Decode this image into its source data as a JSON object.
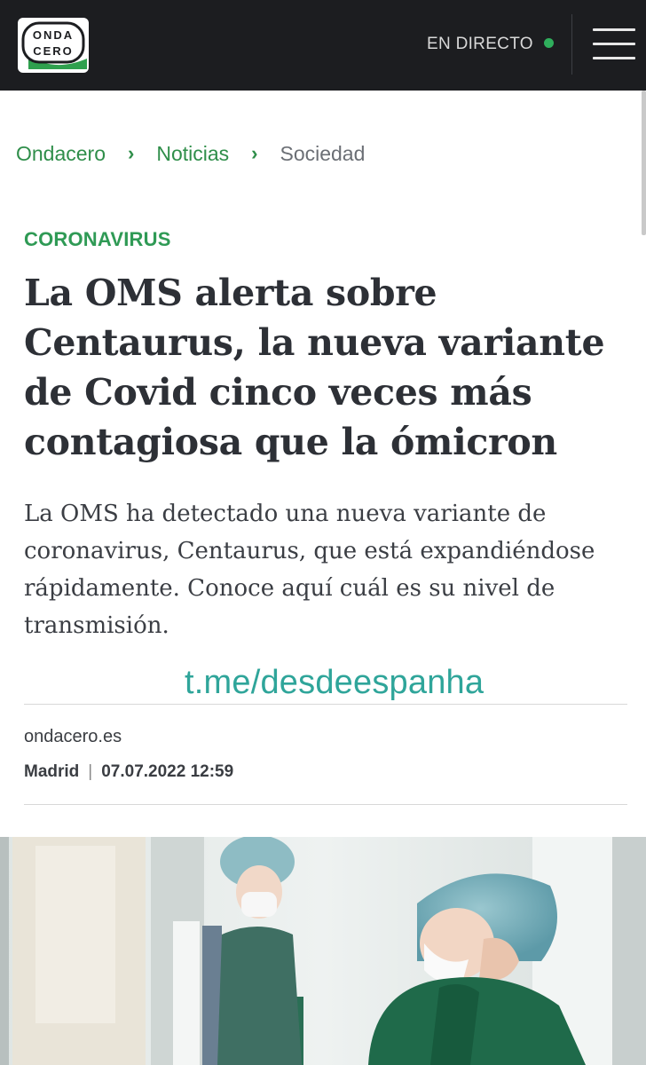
{
  "header": {
    "logo_text_top": "ONDA",
    "logo_text_bottom": "CERO",
    "live_label": "EN DIRECTO",
    "live_dot_color": "#2fae5c",
    "menu_icon": "hamburger-menu-icon"
  },
  "breadcrumb": {
    "items": [
      "Ondacero",
      "Noticias",
      "Sociedad"
    ]
  },
  "article": {
    "section": "CORONAVIRUS",
    "headline": "La OMS alerta sobre Centaurus, la nueva variante de Covid cinco veces más contagiosa que la ómicron",
    "subhead": "La OMS ha detectado una nueva variante de coronavirus, Centaurus, que está expandiéndose rápidamente. Conoce aquí cuál es su nivel de transmisión.",
    "watermark": "t.me/desdeespanha",
    "source": "ondacero.es",
    "city": "Madrid",
    "datetime": "07.07.2022 12:59"
  },
  "colors": {
    "accent": "#2f9a55",
    "header_bg": "#1c1d20",
    "watermark": "#2fa59a"
  }
}
